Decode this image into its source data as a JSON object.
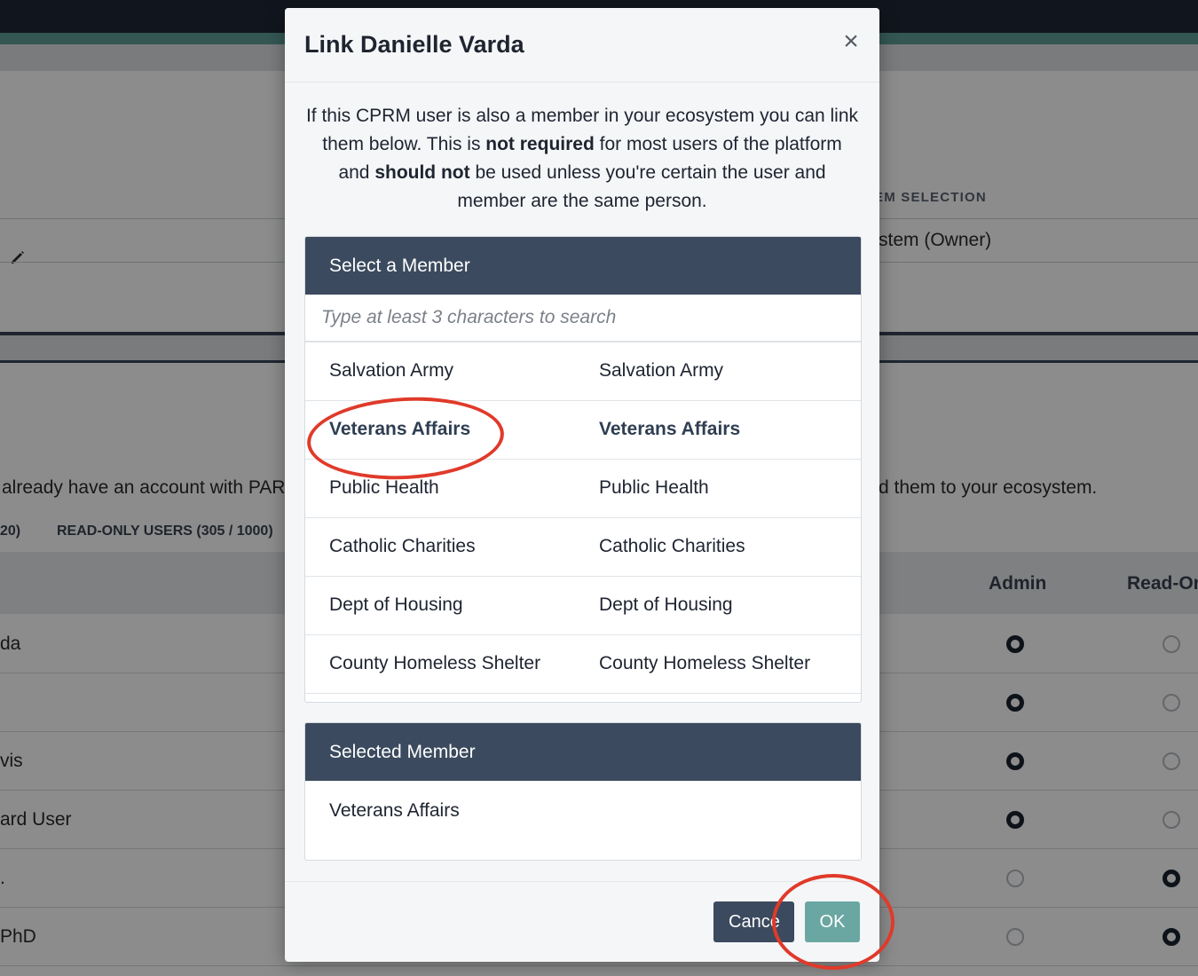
{
  "background": {
    "column_label": "EM SELECTION",
    "column_value": "stem (Owner)",
    "info_text_left": "already have an account with PART",
    "info_text_right": "d them to your ecosystem.",
    "tab_left_fragment": "20)",
    "tab_readonly": "READ-ONLY USERS (305 / 1000)",
    "col_admin": "Admin",
    "col_readonly": "Read-Or",
    "rows": [
      {
        "name": "da",
        "admin": true,
        "readonly": false
      },
      {
        "name": "",
        "admin": true,
        "readonly": false
      },
      {
        "name": "vis",
        "admin": true,
        "readonly": false
      },
      {
        "name": "ard User",
        "admin": true,
        "readonly": false
      },
      {
        "name": ".",
        "admin": false,
        "readonly": true
      },
      {
        "name": "PhD",
        "admin": false,
        "readonly": true
      }
    ]
  },
  "modal": {
    "title": "Link Danielle Varda",
    "close_icon": "×",
    "intro": {
      "p1": "If this CPRM user is also a member in your ecosystem you can link them below. This is ",
      "b1": "not required",
      "p2": " for most users of the platform and ",
      "b2": "should not",
      "p3": " be used unless you're certain the user and member are the same person."
    },
    "select_panel": {
      "heading": "Select a Member",
      "search_placeholder": "Type at least 3 characters to search",
      "members": [
        {
          "col1": "Salvation Army",
          "col2": "Salvation Army"
        },
        {
          "col1": "Veterans Affairs",
          "col2": "Veterans Affairs"
        },
        {
          "col1": "Public Health",
          "col2": "Public Health"
        },
        {
          "col1": "Catholic Charities",
          "col2": "Catholic Charities"
        },
        {
          "col1": "Dept of Housing",
          "col2": "Dept of Housing"
        },
        {
          "col1": "County Homeless Shelter",
          "col2": "County Homeless Shelter"
        }
      ]
    },
    "selected_panel": {
      "heading": "Selected Member",
      "value": "Veterans Affairs"
    },
    "footer": {
      "cancel_label": "Cance",
      "ok_label": "OK"
    }
  },
  "colors": {
    "panel_header": "#3b4a5e",
    "ok_button": "#6aa7a2",
    "annotation": "#e03a2a"
  }
}
